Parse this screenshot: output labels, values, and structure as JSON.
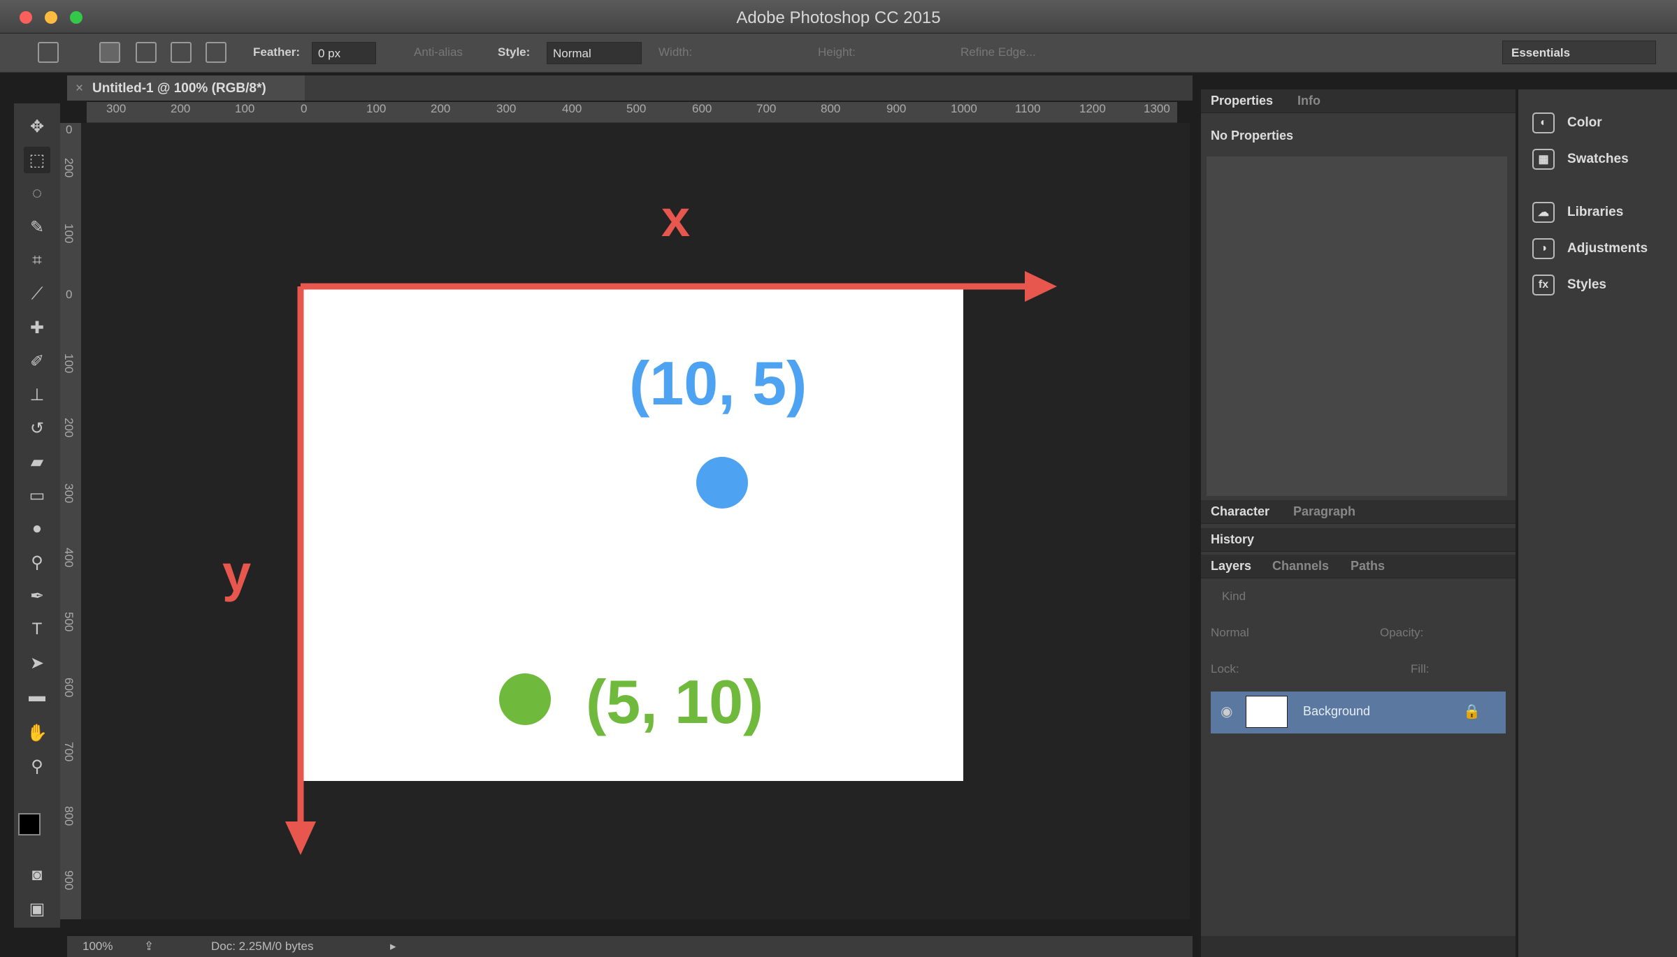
{
  "window": {
    "title": "Adobe Photoshop CC 2015"
  },
  "options_bar": {
    "feather_label": "Feather:",
    "feather_value": "0 px",
    "antialias_label": "Anti-alias",
    "style_label": "Style:",
    "style_value": "Normal",
    "width_label": "Width:",
    "height_label": "Height:",
    "refine_edge_label": "Refine Edge...",
    "workspace": "Essentials"
  },
  "document": {
    "tab_title": "Untitled-1 @ 100% (RGB/8*)"
  },
  "rulers": {
    "horizontal": [
      "300",
      "200",
      "100",
      "0",
      "100",
      "200",
      "300",
      "400",
      "500",
      "600",
      "700",
      "800",
      "900",
      "1000",
      "1100",
      "1200",
      "1300"
    ],
    "vertical": [
      "0",
      "200",
      "100",
      "0",
      "100",
      "200",
      "300",
      "400",
      "500",
      "600",
      "700",
      "800",
      "900"
    ]
  },
  "diagram": {
    "x_axis_label": "x",
    "y_axis_label": "y",
    "point_a": {
      "label": "(10, 5)",
      "color": "#4da3f2"
    },
    "point_b": {
      "label": "(5, 10)",
      "color": "#6fba3c"
    },
    "axis_color": "#e8574e"
  },
  "status_bar": {
    "zoom": "100%",
    "doc_info": "Doc: 2.25M/0 bytes"
  },
  "panels": {
    "properties_tabs": [
      "Properties",
      "Info"
    ],
    "properties_text": "No Properties",
    "character_tabs": [
      "Character",
      "Paragraph"
    ],
    "history_tab": "History",
    "layers_tabs": [
      "Layers",
      "Channels",
      "Paths"
    ],
    "layers_filter": "Kind",
    "blend_mode": "Normal",
    "opacity_label": "Opacity:",
    "lock_label": "Lock:",
    "fill_label": "Fill:",
    "layer_name": "Background"
  },
  "dock": {
    "items": [
      "Color",
      "Swatches",
      "Libraries",
      "Adjustments",
      "Styles"
    ]
  }
}
